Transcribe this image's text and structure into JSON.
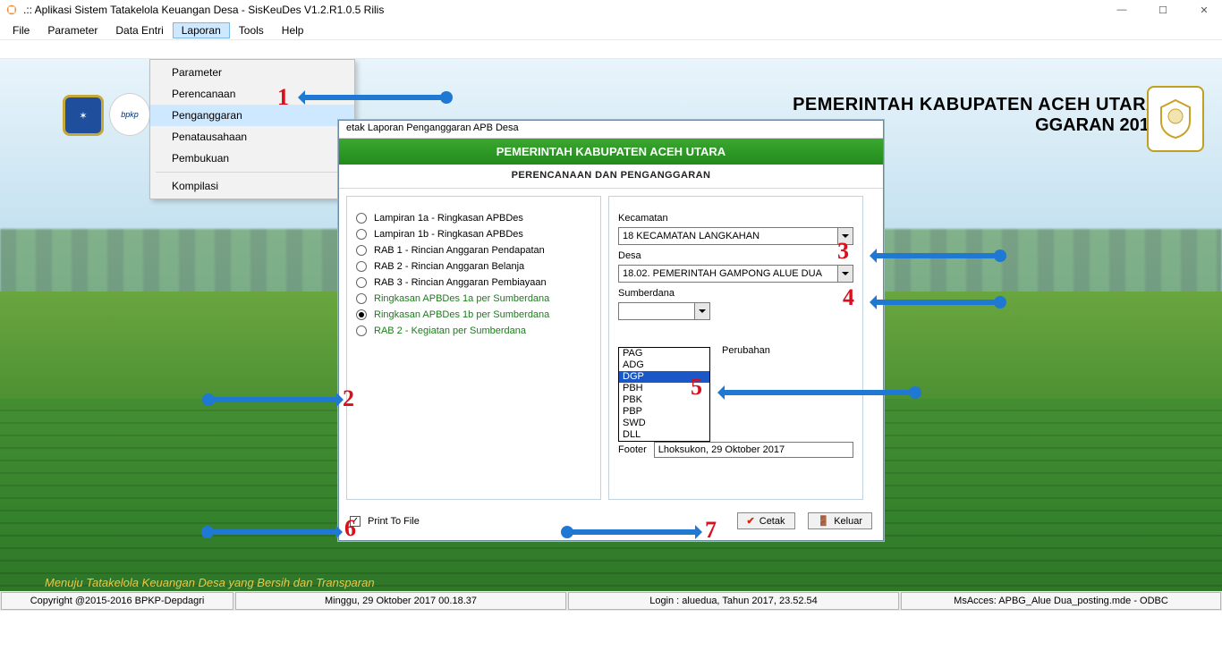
{
  "window": {
    "title": ".:: Aplikasi Sistem Tatakelola Keuangan Desa - SisKeuDes V1.2.R1.0.5 Rilis"
  },
  "menus": {
    "items": [
      "File",
      "Parameter",
      "Data Entri",
      "Laporan",
      "Tools",
      "Help"
    ],
    "open_index": 3
  },
  "dropdown": {
    "items": [
      "Parameter",
      "Perencanaan",
      "Penganggaran",
      "Penatausahaan",
      "Pembukuan",
      "Kompilasi"
    ],
    "selected_index": 2
  },
  "header": {
    "line1": "PEMERINTAH KABUPATEN ACEH UTARA",
    "line2_suffix": "GGARAN 2017"
  },
  "dialog": {
    "title": "etak Laporan Penganggaran APB Desa",
    "greenbar": "PEMERINTAH KABUPATEN ACEH UTARA",
    "subbar": "PERENCANAAN DAN PENGANGGARAN",
    "radios": [
      {
        "label": "Lampiran 1a - Ringkasan APBDes",
        "green": false,
        "selected": false
      },
      {
        "label": "Lampiran 1b - Ringkasan APBDes",
        "green": false,
        "selected": false
      },
      {
        "label": "RAB 1 - Rincian Anggaran Pendapatan",
        "green": false,
        "selected": false
      },
      {
        "label": "RAB 2 - Rincian Anggaran Belanja",
        "green": false,
        "selected": false
      },
      {
        "label": "RAB 3 - Rincian Anggaran Pembiayaan",
        "green": false,
        "selected": false
      },
      {
        "label": "Ringkasan APBDes 1a per Sumberdana",
        "green": true,
        "selected": false
      },
      {
        "label": "Ringkasan APBDes 1b per Sumberdana",
        "green": true,
        "selected": true
      },
      {
        "label": "RAB 2 - Kegiatan per Sumberdana",
        "green": true,
        "selected": false
      }
    ],
    "right": {
      "kecamatan_label": "Kecamatan",
      "kecamatan_value": "18  KECAMATAN LANGKAHAN",
      "desa_label": "Desa",
      "desa_value": "18.02.  PEMERINTAH GAMPONG ALUE DUA",
      "sumberdana_label": "Sumberdana",
      "sumberdana_value": "",
      "listbox": [
        "PAG",
        "ADG",
        "DGP",
        "PBH",
        "PBK",
        "PBP",
        "SWD",
        "DLL"
      ],
      "listbox_selected_index": 2,
      "perubahan_label": "Perubahan",
      "footer_label": "Footer",
      "footer_value": "Lhoksukon, 29 Oktober 2017"
    },
    "actions": {
      "print_to_file_label": "Print To File",
      "print_to_file_checked": true,
      "cetak_label": "Cetak",
      "keluar_label": "Keluar"
    }
  },
  "slogan": "Menuju Tatakelola Keuangan Desa yang Bersih dan Transparan",
  "status": {
    "copyright": "Copyright @2015-2016 BPKP-Depdagri",
    "datetime": "Minggu, 29 Oktober 2017  00.18.37",
    "login": "Login : aluedua,  Tahun 2017, 23.52.54",
    "db": "MsAcces: APBG_Alue Dua_posting.mde - ODBC"
  },
  "annotations": {
    "n1": "1",
    "n2": "2",
    "n3": "3",
    "n4": "4",
    "n5": "5",
    "n6": "6",
    "n7": "7"
  }
}
